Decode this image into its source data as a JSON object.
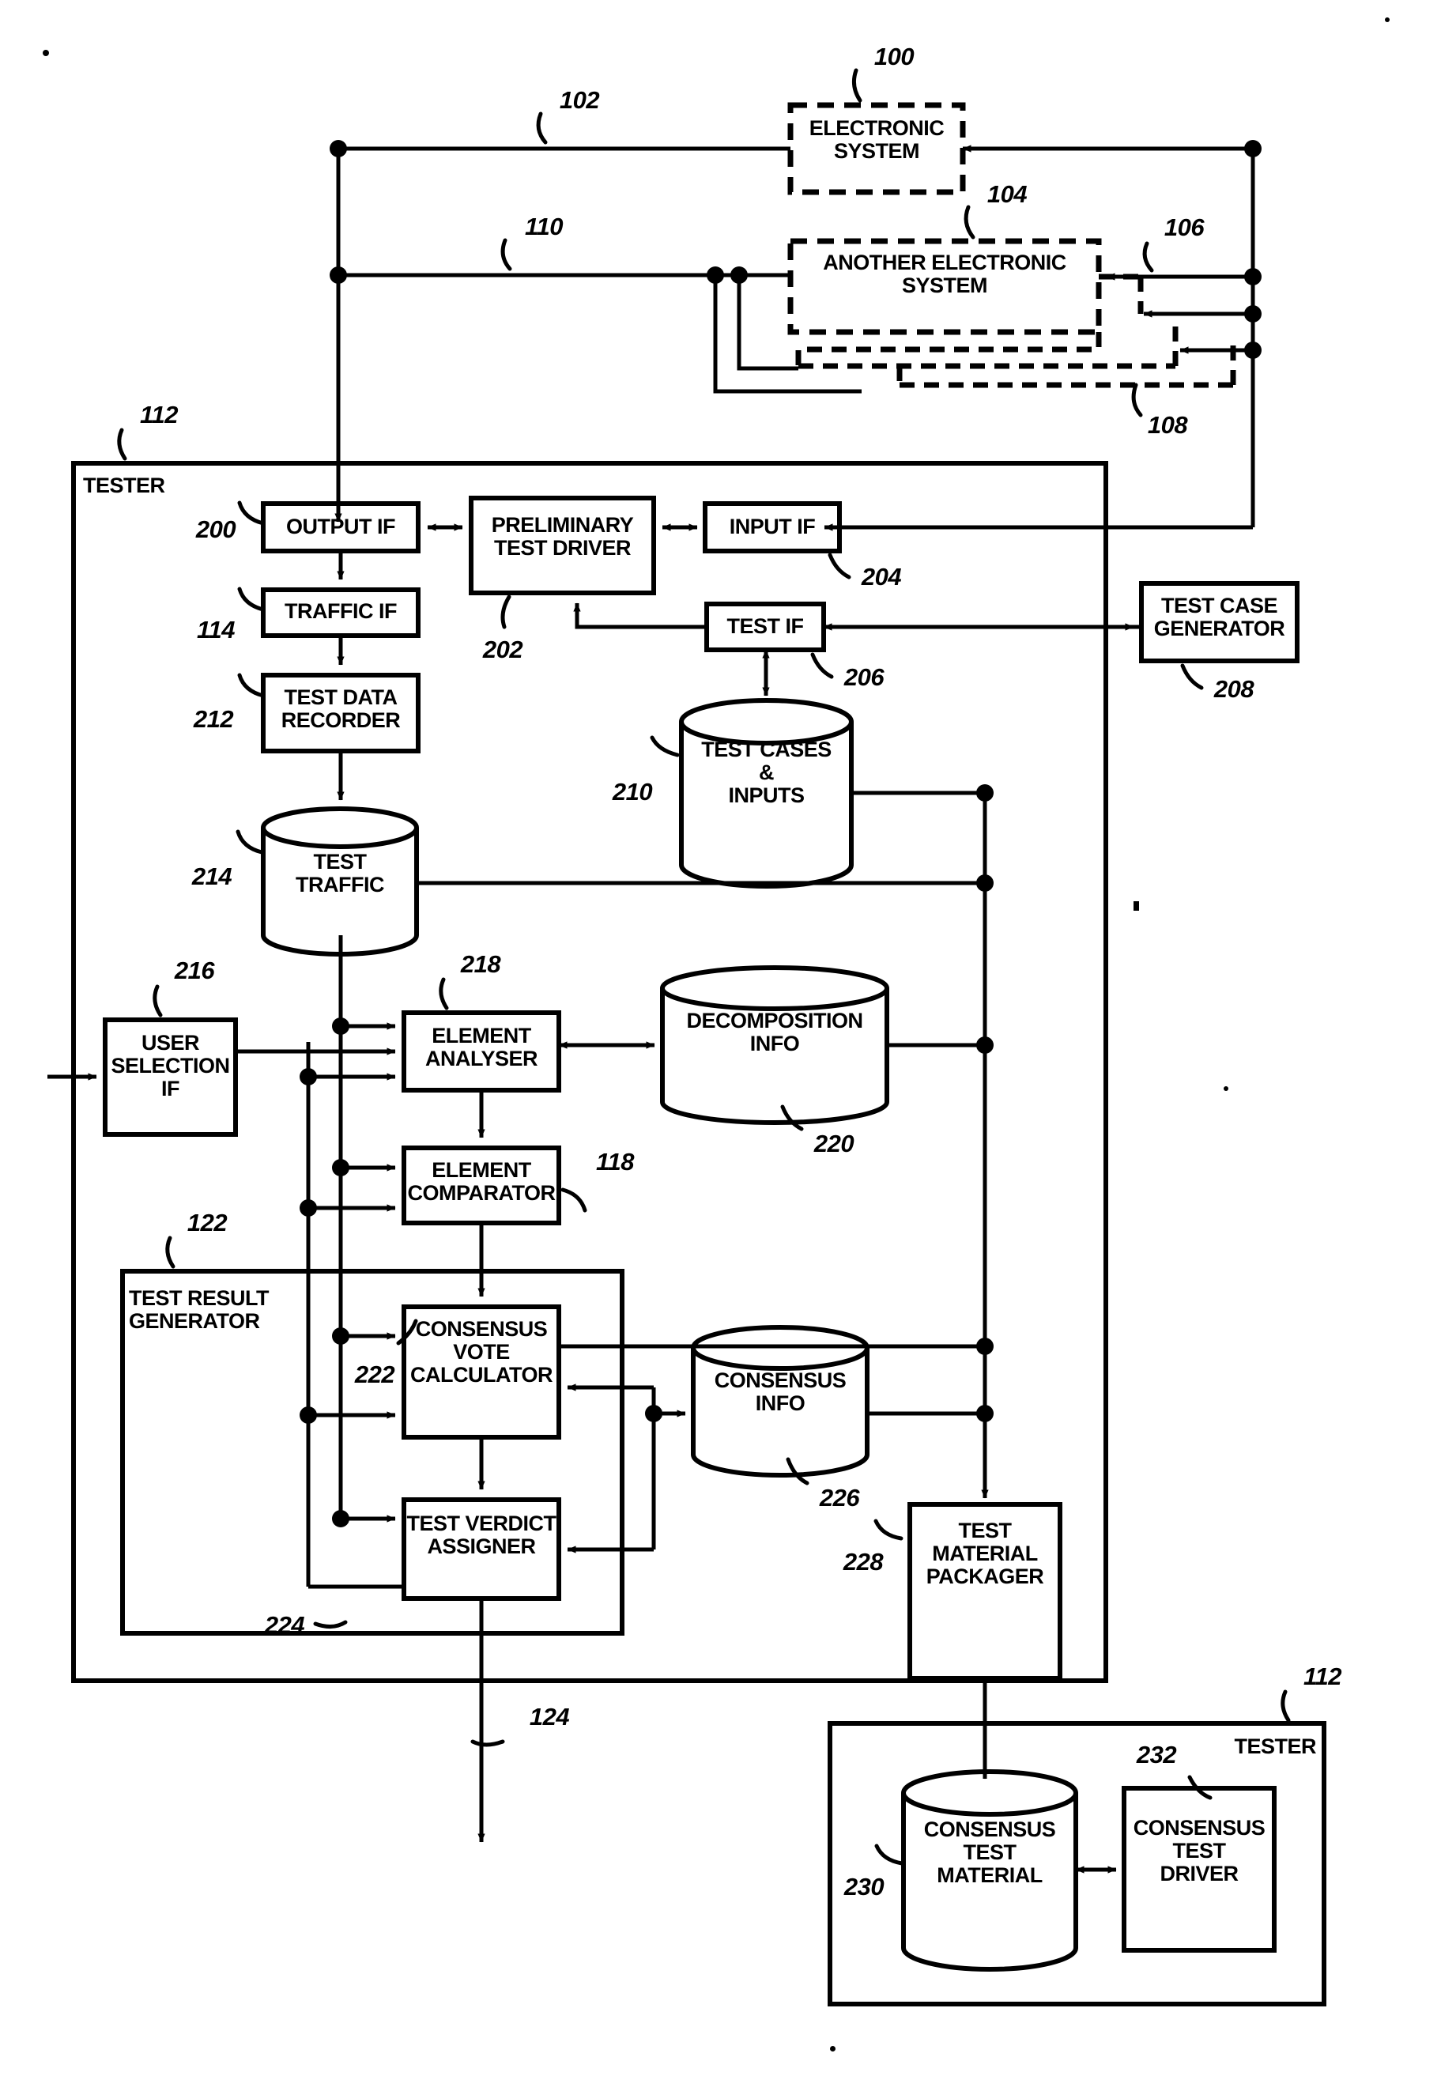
{
  "figure": {
    "type": "patent-block-diagram",
    "background": "#ffffff",
    "ink": "#000000"
  },
  "blocks": {
    "electronic_system": "ELECTRONIC\nSYSTEM",
    "another_electronic_system": "ANOTHER ELECTRONIC\nSYSTEM",
    "tester_top_title": "TESTER",
    "output_if": "OUTPUT IF",
    "preliminary_test_driver": "PRELIMINARY\nTEST DRIVER",
    "input_if": "INPUT IF",
    "traffic_if": "TRAFFIC IF",
    "test_if": "TEST IF",
    "test_case_generator": "TEST CASE\nGENERATOR",
    "test_data_recorder": "TEST DATA\nRECORDER",
    "test_cases_inputs": "TEST CASES\n&\nINPUTS",
    "test_traffic": "TEST\nTRAFFIC",
    "user_selection_if": "USER\nSELECTION\nIF",
    "element_analyser": "ELEMENT\nANALYSER",
    "decomposition_info": "DECOMPOSITION\nINFO",
    "element_comparator": "ELEMENT\nCOMPARATOR",
    "test_result_generator": "TEST RESULT\nGENERATOR",
    "consensus_vote_calculator": "CONSENSUS\nVOTE\nCALCULATOR",
    "consensus_info": "CONSENSUS\nINFO",
    "test_verdict_assigner": "TEST VERDICT\nASSIGNER",
    "test_material_packager": "TEST\nMATERIAL\nPACKAGER",
    "tester_bottom_title": "TESTER",
    "consensus_test_material": "CONSENSUS\nTEST\nMATERIAL",
    "consensus_test_driver": "CONSENSUS\nTEST\nDRIVER"
  },
  "reference_numerals": {
    "n100": "100",
    "n102": "102",
    "n104": "104",
    "n106": "106",
    "n108": "108",
    "n110": "110",
    "n112_top": "112",
    "n112_bottom": "112",
    "n114": "114",
    "n118": "118",
    "n122": "122",
    "n124": "124",
    "n200": "200",
    "n202": "202",
    "n204": "204",
    "n206": "206",
    "n208": "208",
    "n210": "210",
    "n212": "212",
    "n214": "214",
    "n216": "216",
    "n218": "218",
    "n220": "220",
    "n222": "222",
    "n224": "224",
    "n226": "226",
    "n228": "228",
    "n230": "230",
    "n232": "232"
  }
}
